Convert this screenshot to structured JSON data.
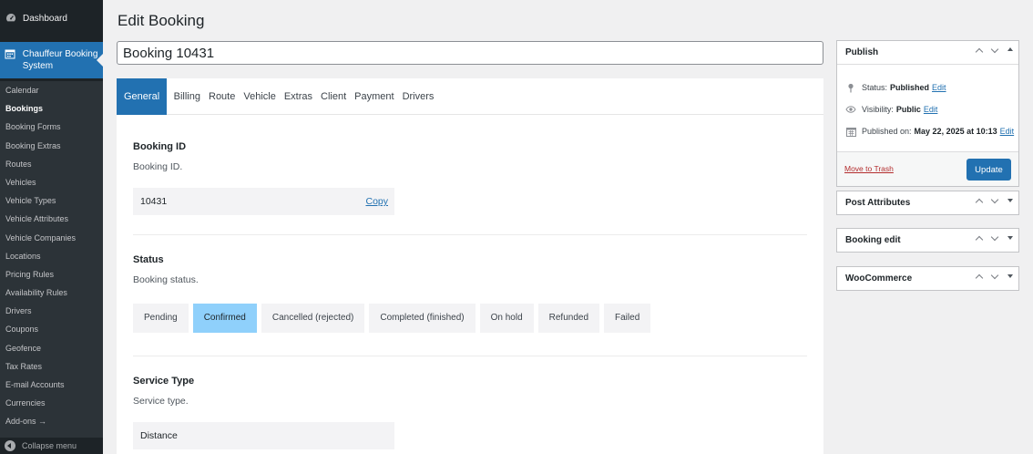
{
  "menu": {
    "dashboard": "Dashboard",
    "current": "Chauffeur Booking System",
    "submenu": [
      "Calendar",
      "Bookings",
      "Booking Forms",
      "Booking Extras",
      "Routes",
      "Vehicles",
      "Vehicle Types",
      "Vehicle Attributes",
      "Vehicle Companies",
      "Locations",
      "Pricing Rules",
      "Availability Rules",
      "Drivers",
      "Coupons",
      "Geofence",
      "Tax Rates",
      "E-mail Accounts",
      "Currencies",
      "Add-ons →"
    ],
    "collapse": "Collapse menu"
  },
  "page": {
    "title": "Edit Booking",
    "post_title": "Booking 10431"
  },
  "tabs": [
    "General",
    "Billing",
    "Route",
    "Vehicle",
    "Extras",
    "Client",
    "Payment",
    "Drivers"
  ],
  "general": {
    "booking_id": {
      "title": "Booking ID",
      "desc": "Booking ID.",
      "value": "10431",
      "copy": "Copy"
    },
    "status": {
      "title": "Status",
      "desc": "Booking status.",
      "options": [
        "Pending",
        "Confirmed",
        "Cancelled (rejected)",
        "Completed (finished)",
        "On hold",
        "Refunded",
        "Failed"
      ],
      "selected": "Confirmed"
    },
    "service_type": {
      "title": "Service Type",
      "desc": "Service type.",
      "value": "Distance"
    }
  },
  "publish": {
    "title": "Publish",
    "status_label": "Status:",
    "status_value": "Published",
    "visibility_label": "Visibility:",
    "visibility_value": "Public",
    "published_label": "Published on:",
    "published_value": "May 22, 2025 at 10:13",
    "edit": "Edit",
    "trash": "Move to Trash",
    "update": "Update"
  },
  "boxes": [
    "Post Attributes",
    "Booking edit",
    "WooCommerce"
  ],
  "colors": {
    "accent": "#2271b1",
    "selected_status": "#8fd0fb",
    "sidebar": "#1d2327"
  }
}
